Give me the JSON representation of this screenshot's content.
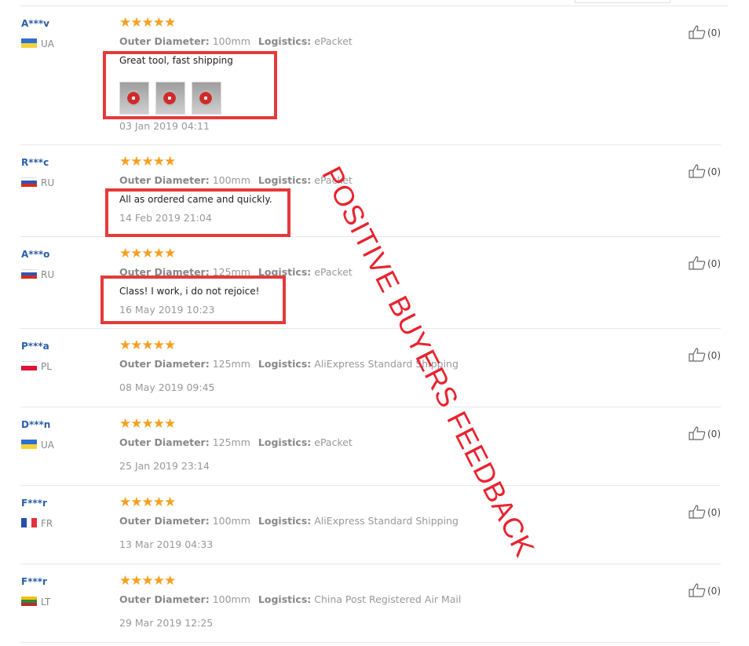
{
  "overlay_text": "POSITIVE BUYERS FEEDBACK",
  "labels": {
    "outer_diameter": "Outer Diameter:",
    "logistics": "Logistics:"
  },
  "reviews": [
    {
      "user": "A***v",
      "country": "UA",
      "stars": "★★★★★",
      "outer_diameter": "100mm",
      "logistics": "ePacket",
      "text": "Great tool, fast shipping",
      "date": "03 Jan 2019 04:11",
      "helpful": "(0)"
    },
    {
      "user": "R***c",
      "country": "RU",
      "stars": "★★★★★",
      "outer_diameter": "100mm",
      "logistics": "ePacket",
      "text": "All as ordered came and quickly.",
      "date": "14 Feb 2019 21:04",
      "helpful": "(0)"
    },
    {
      "user": "A***o",
      "country": "RU",
      "stars": "★★★★★",
      "outer_diameter": "125mm",
      "logistics": "ePacket",
      "text": "Class! I work, i do not rejoice!",
      "date": "16 May 2019 10:23",
      "helpful": "(0)"
    },
    {
      "user": "P***a",
      "country": "PL",
      "stars": "★★★★★",
      "outer_diameter": "125mm",
      "logistics": "AliExpress Standard Shipping",
      "date": "08 May 2019 09:45",
      "helpful": "(0)"
    },
    {
      "user": "D***n",
      "country": "UA",
      "stars": "★★★★★",
      "outer_diameter": "125mm",
      "logistics": "ePacket",
      "date": "25 Jan 2019 23:14",
      "helpful": "(0)"
    },
    {
      "user": "F***r",
      "country": "FR",
      "stars": "★★★★★",
      "outer_diameter": "100mm",
      "logistics": "AliExpress Standard Shipping",
      "date": "13 Mar 2019 04:33",
      "helpful": "(0)"
    },
    {
      "user": "F***r",
      "country": "LT",
      "stars": "★★★★★",
      "outer_diameter": "100mm",
      "logistics": "China Post Registered Air Mail",
      "date": "29 Mar 2019 12:25",
      "helpful": "(0)"
    }
  ],
  "icons": {
    "helpful": "thumbs-up-icon",
    "rating": "star-icon"
  },
  "colors": {
    "highlight_box": "#e43a3a",
    "overlay": "#e8232f",
    "stars": "#f5a021",
    "username": "#2a5ea8"
  }
}
